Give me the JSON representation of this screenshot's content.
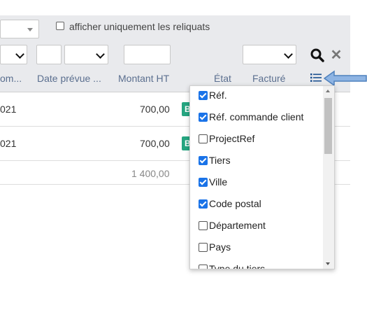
{
  "filters": {
    "reliquats_label": "afficher uniquement les reliquats",
    "reliquats_checked": false
  },
  "columns": {
    "h1": "om...",
    "date_prevue": "Date prévue ...",
    "montant_ht": "Montant HT",
    "etat": "État",
    "facture": "Facturé"
  },
  "rows": [
    {
      "date": "021",
      "montant": "700,00",
      "badge": "B"
    },
    {
      "date": "021",
      "montant": "700,00",
      "badge": "B"
    }
  ],
  "total": "1 400,00",
  "column_picker": {
    "options": [
      {
        "label": "Réf.",
        "checked": true
      },
      {
        "label": "Réf. commande client",
        "checked": true
      },
      {
        "label": "ProjectRef",
        "checked": false
      },
      {
        "label": "Tiers",
        "checked": true
      },
      {
        "label": "Ville",
        "checked": true
      },
      {
        "label": "Code postal",
        "checked": true
      },
      {
        "label": "Département",
        "checked": false
      },
      {
        "label": "Pays",
        "checked": false
      },
      {
        "label": "Type du tiers",
        "checked": false
      }
    ]
  },
  "colors": {
    "header_bg": "#e9eaed",
    "header_text": "#5b6f8f",
    "checkbox_accent": "#1a73e8",
    "badge_green": "#25a580",
    "annotation_arrow": "#4f81bd"
  },
  "icons": [
    "chevron-down-icon",
    "search-icon",
    "close-icon",
    "list-icon",
    "annotation-arrow-icon"
  ]
}
